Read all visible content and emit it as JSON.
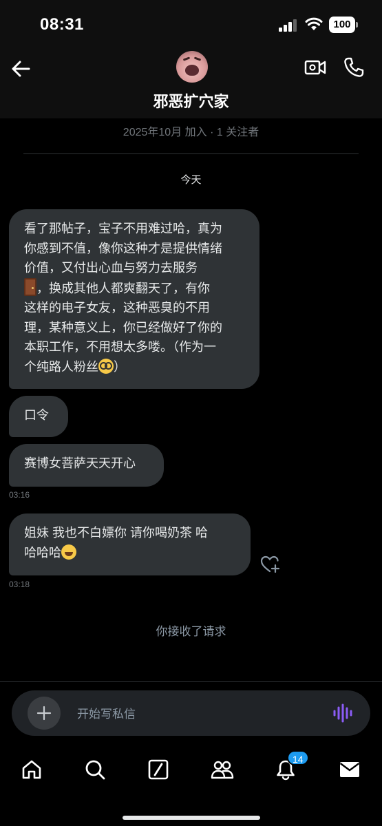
{
  "status_bar": {
    "time": "08:31",
    "battery": "100"
  },
  "header": {
    "name": "邪恶扩穴家"
  },
  "subtitle": "2025年10月 加入 · 1 关注者",
  "date_separator": "今天",
  "messages": [
    {
      "line1": "看了那帖子，宝子不用难过哈，真为",
      "line2": "你感到不值，像你这种才是提供情绪",
      "line3": "价值，又付出心血与努力去服务",
      "line4_after_emoji": "，换成其他人都爽翻天了，有你",
      "line5": "这样的电子女友，这种恶臭的不用",
      "line6": "理，某种意义上，你已经做好了你的",
      "line7": "本职工作，不用想太多喽。（作为一",
      "line8_before_emoji": "个纯路人粉丝",
      "line8_after_emoji": "）"
    },
    {
      "text": "口令"
    },
    {
      "text": "赛博女菩萨天天开心",
      "time": "03:16"
    },
    {
      "line1": "姐妹  我也不白嫖你  请你喝奶茶  哈",
      "line2_before_emoji": "哈哈哈",
      "time": "03:18"
    }
  ],
  "system_message": "你接收了请求",
  "composer": {
    "placeholder": "开始写私信"
  },
  "nav": {
    "notifications_badge": "14"
  },
  "icons": {
    "back": "arrow-left-icon",
    "video": "video-camera-icon",
    "phone": "phone-icon",
    "react": "heart-plus-icon",
    "add": "plus-icon",
    "voice": "voice-wave-icon",
    "home": "home-icon",
    "search": "search-icon",
    "grok": "slash-square-icon",
    "communities": "people-icon",
    "notifications": "bell-icon",
    "messages": "envelope-icon"
  },
  "colors": {
    "accent": "#1d9bf0",
    "bubble": "#2f3336",
    "voice": "#8b5cf6"
  }
}
